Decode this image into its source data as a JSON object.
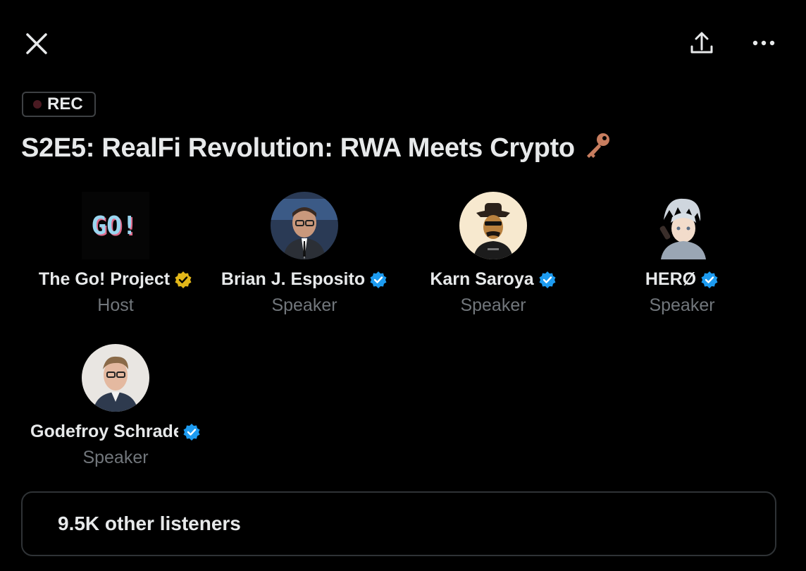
{
  "header": {
    "close_icon": "close-icon",
    "share_icon": "share-icon",
    "more_icon": "more-icon"
  },
  "recording": {
    "badge_label": "REC",
    "dot_color": "#4a1a22"
  },
  "space": {
    "title": "S2E5: RealFi Revolution: RWA Meets Crypto",
    "title_emoji_icon": "key-icon"
  },
  "participants": [
    {
      "name": "The Go! Project",
      "role": "Host",
      "verified": "gold",
      "avatar_text": "GO!"
    },
    {
      "name": "Brian J. Esposito",
      "role": "Speaker",
      "verified": "blue"
    },
    {
      "name": "Karn Saroya",
      "role": "Speaker",
      "verified": "blue"
    },
    {
      "name": "HERØ",
      "role": "Speaker",
      "verified": "blue"
    },
    {
      "name": "Godefroy Schrader",
      "role": "Speaker",
      "verified": "blue"
    }
  ],
  "listeners": {
    "label": "9.5K other listeners"
  },
  "colors": {
    "background": "#000000",
    "text": "#e7e9ea",
    "muted": "#71767b",
    "verified_blue": "#1d9bf0",
    "verified_gold": "#e2b719"
  }
}
